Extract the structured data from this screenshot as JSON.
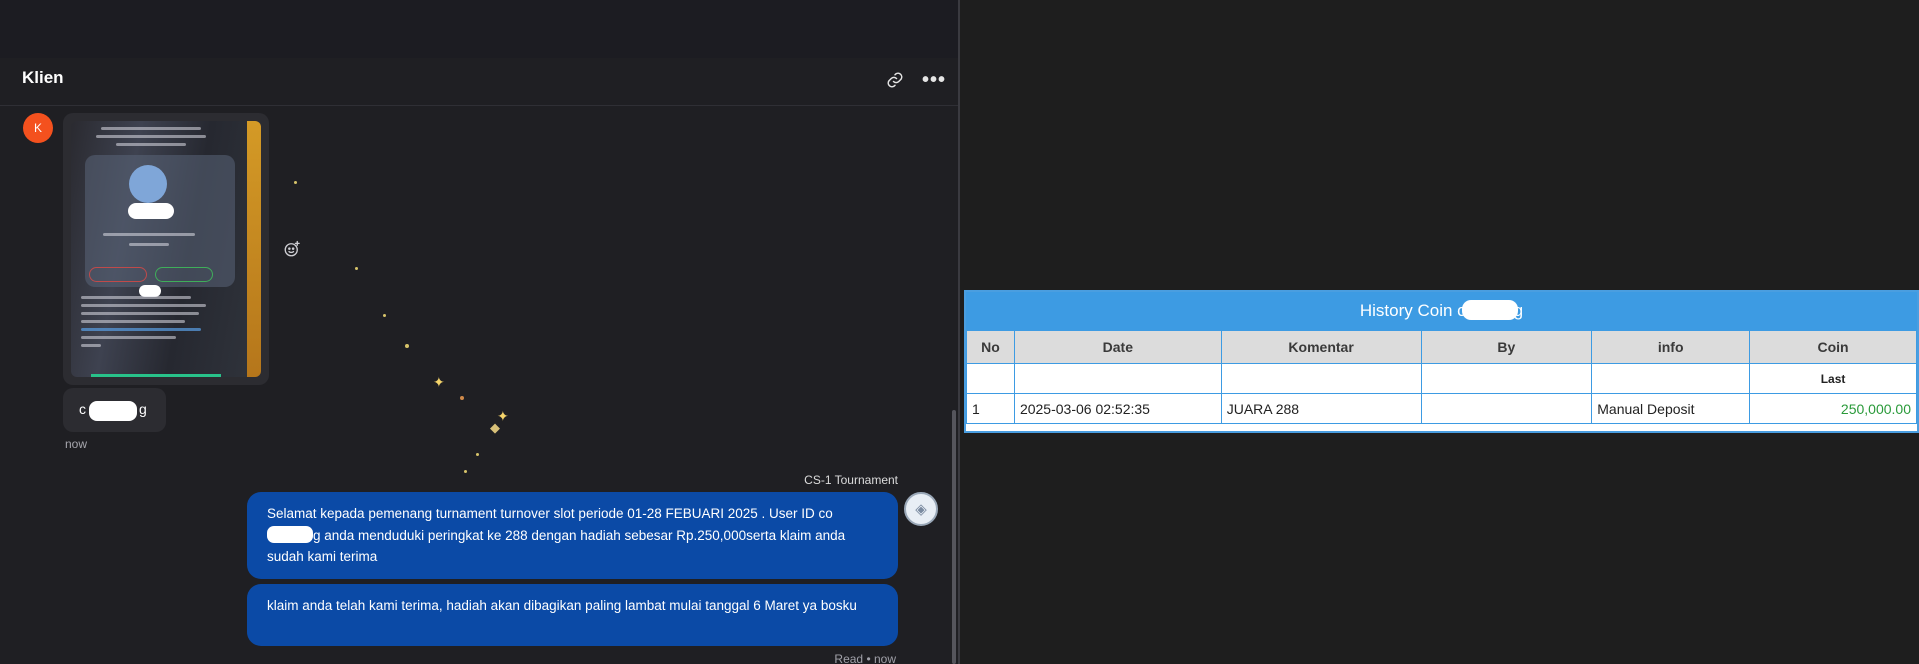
{
  "chat": {
    "title": "Klien",
    "client_avatar_letter": "K",
    "client_name_prefix": "c",
    "client_name_suffix": "g",
    "client_message_time": "now",
    "agent_sender": "CS-1 Tournament",
    "messages": [
      {
        "part1": "Selamat kepada pemenang turnament turnover slot periode 01-28 FEBUARI 2025 . User ID co",
        "part2": "g anda menduduki peringkat ke 288 dengan hadiah sebesar Rp.250,000serta klaim anda sudah kami terima"
      },
      {
        "text": "klaim anda telah kami terima, hadiah akan dibagikan paling lambat mulai tanggal 6 Maret ya bosku"
      }
    ],
    "read_status": "Read • now",
    "icons": {
      "link": "link-icon",
      "more": "more-icon",
      "reaction": "add-reaction-icon"
    }
  },
  "history": {
    "title_prefix": "History Coin c",
    "title_suffix": "g",
    "columns": [
      "No",
      "Date",
      "Komentar",
      "By",
      "info",
      "Coin"
    ],
    "last_label": "Last",
    "rows": [
      {
        "no": "1",
        "date": "2025-03-06 02:52:35",
        "komentar": "JUARA 288",
        "by": "",
        "info": "Manual Deposit",
        "coin": "250,000.00"
      }
    ],
    "colors": {
      "header": "#3d9be3",
      "amount": "#2a9a3a"
    }
  }
}
